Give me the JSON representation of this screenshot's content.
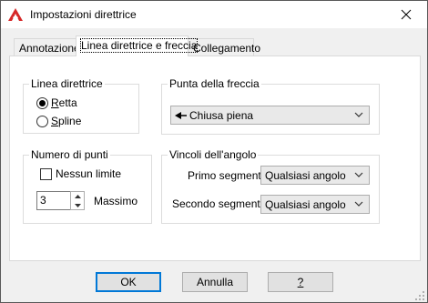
{
  "window": {
    "title": "Impostazioni direttrice",
    "icon": "autocad-icon",
    "close_icon": "close-icon"
  },
  "tabs": [
    {
      "label": "Annotazione",
      "active": false
    },
    {
      "label": "Linea direttrice e freccia",
      "active": true
    },
    {
      "label": "Collegamento",
      "active": false
    }
  ],
  "leader_line": {
    "title": "Linea direttrice",
    "options": [
      {
        "label": "Retta",
        "checked": true
      },
      {
        "label": "Spline",
        "checked": false
      }
    ]
  },
  "arrowhead": {
    "title": "Punta della freccia",
    "value": "Chiusa piena"
  },
  "num_points": {
    "title": "Numero di punti",
    "no_limit_label": "Nessun limite",
    "no_limit_checked": false,
    "value": "3",
    "max_label": "Massimo"
  },
  "angle_constraints": {
    "title": "Vincoli dell'angolo",
    "first_label": "Primo segmento:",
    "first_value": "Qualsiasi angolo",
    "second_label": "Secondo segmento:",
    "second_value": "Qualsiasi angolo"
  },
  "buttons": {
    "ok": "OK",
    "cancel": "Annulla",
    "help": "?"
  }
}
